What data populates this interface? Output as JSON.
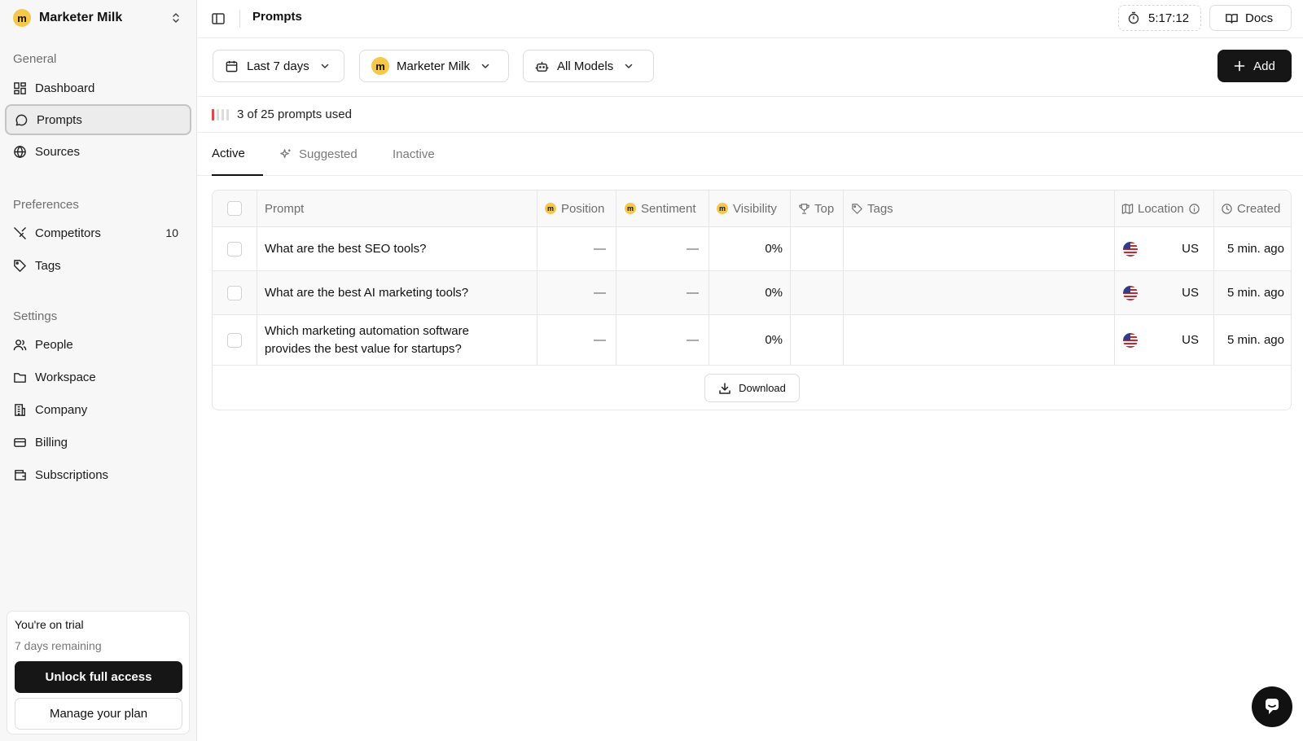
{
  "workspace": {
    "logo_letter": "m",
    "name": "Marketer Milk"
  },
  "sidebar": {
    "general_title": "General",
    "general": [
      {
        "label": "Dashboard",
        "icon": "dashboard-icon"
      },
      {
        "label": "Prompts",
        "icon": "chat-bubble-icon",
        "active": true
      },
      {
        "label": "Sources",
        "icon": "globe-icon"
      }
    ],
    "preferences_title": "Preferences",
    "preferences": [
      {
        "label": "Competitors",
        "icon": "swords-icon",
        "count": "10"
      },
      {
        "label": "Tags",
        "icon": "tag-icon"
      }
    ],
    "settings_title": "Settings",
    "settings": [
      {
        "label": "People",
        "icon": "users-icon"
      },
      {
        "label": "Workspace",
        "icon": "folder-icon"
      },
      {
        "label": "Company",
        "icon": "building-icon"
      },
      {
        "label": "Billing",
        "icon": "credit-card-icon"
      },
      {
        "label": "Subscriptions",
        "icon": "wallet-icon"
      }
    ],
    "trial": {
      "title": "You're on trial",
      "remaining": "7 days remaining",
      "unlock_label": "Unlock full access",
      "manage_label": "Manage your plan"
    }
  },
  "header": {
    "title": "Prompts",
    "timer": "5:17:12",
    "docs_label": "Docs"
  },
  "filters": {
    "date_range": "Last 7 days",
    "brand": "Marketer Milk",
    "models": "All Models",
    "add_label": "Add"
  },
  "usage": {
    "text": "3 of 25 prompts used",
    "used": 3,
    "limit": 25,
    "accent": "#e0474c"
  },
  "tabs": [
    {
      "label": "Active",
      "active": true
    },
    {
      "label": "Suggested",
      "icon": "sparkles-icon"
    },
    {
      "label": "Inactive"
    }
  ],
  "table": {
    "columns": {
      "prompt": "Prompt",
      "position": "Position",
      "sentiment": "Sentiment",
      "visibility": "Visibility",
      "top": "Top",
      "tags": "Tags",
      "location": "Location",
      "created": "Created"
    },
    "rows": [
      {
        "prompt": "What are the best SEO tools?",
        "position": "—",
        "sentiment": "—",
        "visibility": "0%",
        "top": "",
        "tags": "",
        "country": "US",
        "created": "5 min. ago"
      },
      {
        "prompt": "What are the best AI marketing tools?",
        "position": "—",
        "sentiment": "—",
        "visibility": "0%",
        "top": "",
        "tags": "",
        "country": "US",
        "created": "5 min. ago"
      },
      {
        "prompt_line1": "Which marketing automation software",
        "prompt_line2": "provides the best value for startups?",
        "position": "—",
        "sentiment": "—",
        "visibility": "0%",
        "top": "",
        "tags": "",
        "country": "US",
        "created": "5 min. ago"
      }
    ],
    "download_label": "Download"
  }
}
